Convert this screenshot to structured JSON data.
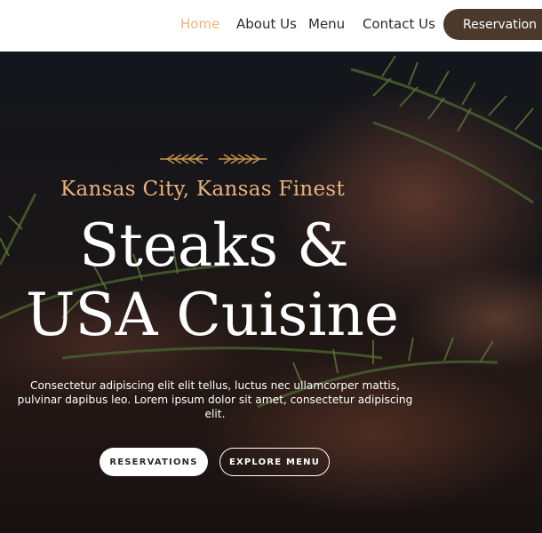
{
  "nav": {
    "items": [
      {
        "label": "Home",
        "active": true
      },
      {
        "label": "About Us",
        "active": false
      },
      {
        "label": "Menu",
        "active": false
      },
      {
        "label": "Contact Us",
        "active": false
      }
    ],
    "reservation_label": "Reservation"
  },
  "hero": {
    "tagline": "Kansas City, Kansas Finest",
    "headline_line1": "Steaks &",
    "headline_line2": "USA Cuisine",
    "description": "Consectetur adipiscing elit elit tellus, luctus nec ullamcorper mattis, pulvinar dapibus leo. Lorem ipsum dolor sit amet, consectetur adipiscing elit.",
    "primary_cta": "RESERVATIONS",
    "secondary_cta": "EXPLORE MENU"
  },
  "colors": {
    "accent": "#f0b27a",
    "brand_button": "#4b3a2c",
    "tagline": "#e9b27c"
  },
  "icons": {
    "ornament": "wheat-ornament-icon"
  }
}
